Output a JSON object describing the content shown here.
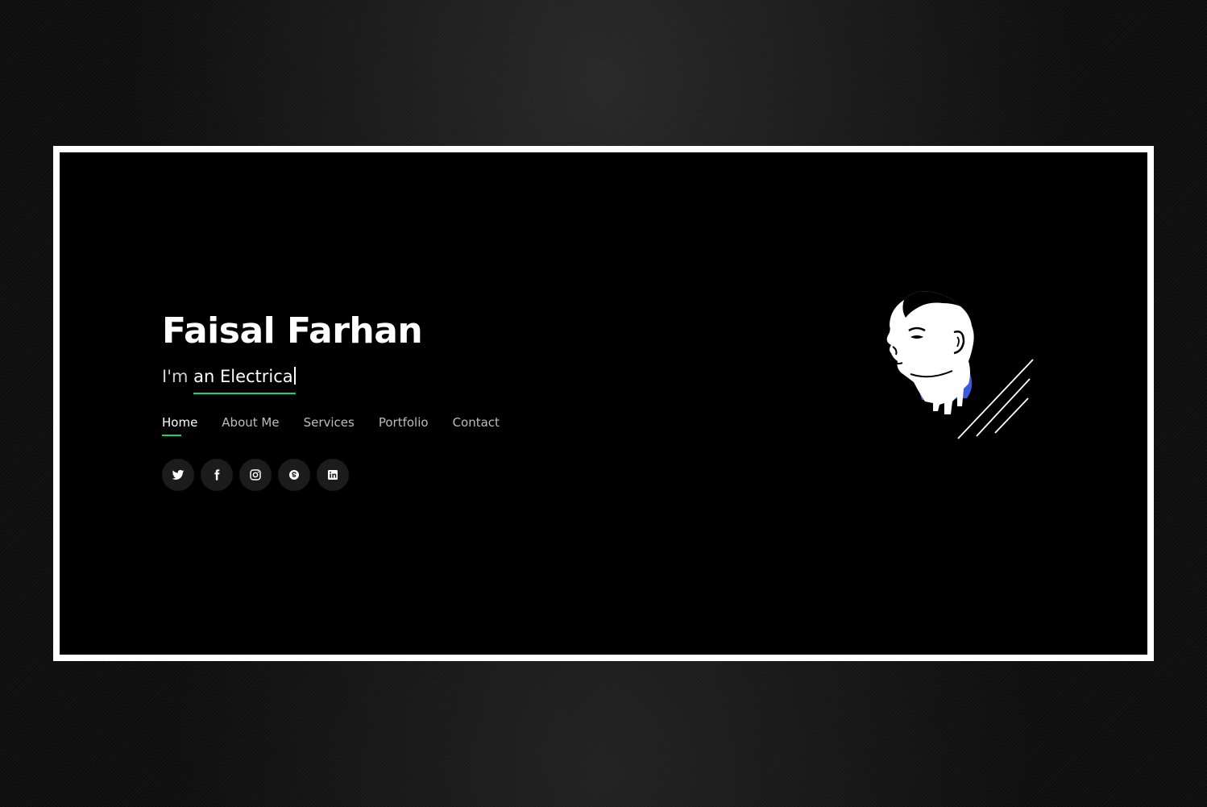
{
  "hero": {
    "name": "Faisal Farhan",
    "intro": "I'm",
    "typed_text": "an Electrica"
  },
  "nav": {
    "items": [
      {
        "label": "Home",
        "active": true
      },
      {
        "label": "About Me",
        "active": false
      },
      {
        "label": "Services",
        "active": false
      },
      {
        "label": "Portfolio",
        "active": false
      },
      {
        "label": "Contact",
        "active": false
      }
    ]
  },
  "social": {
    "icons": [
      "twitter-icon",
      "facebook-icon",
      "instagram-icon",
      "skype-icon",
      "linkedin-icon"
    ]
  },
  "colors": {
    "accent": "#18d26e",
    "background": "#000000",
    "frame": "#ffffff",
    "text": "#ffffff",
    "nav_inactive": "#bdbdbd",
    "social_bg": "#1c1c1c",
    "portrait_shadow": "#3b5bdb"
  }
}
